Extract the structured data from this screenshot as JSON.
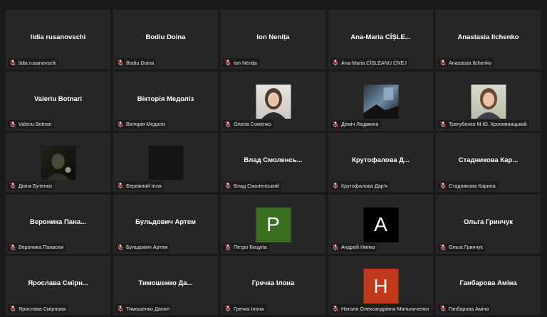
{
  "tiles": [
    {
      "display": "lidia rusanovschi",
      "label": "lidia rusanovschi",
      "type": "name"
    },
    {
      "display": "Bodiu Doina",
      "label": "Bodiu Doina",
      "type": "name"
    },
    {
      "display": "Ion Nenița",
      "label": "Ion Nenița",
      "type": "name"
    },
    {
      "display": "Ana-Maria CÎȘLE...",
      "label": "Ana-Maria CÎȘLEANU CNEJ",
      "type": "name"
    },
    {
      "display": "Anastasia Ilchenko",
      "label": "Anastasia Ilchenko",
      "type": "name"
    },
    {
      "display": "Valeriu Botnari",
      "label": "Valeriu Botnari",
      "type": "name"
    },
    {
      "display": "Вікторія Медоліз",
      "label": "Вікторія Медоліз",
      "type": "name"
    },
    {
      "display": "",
      "label": "Олена Соменко",
      "type": "video",
      "video": "portrait-light"
    },
    {
      "display": "",
      "label": "Деміч Людмила",
      "type": "video",
      "video": "dark-window"
    },
    {
      "display": "",
      "label": "Трегубенко М.Ю. Кропивницький",
      "type": "video",
      "video": "portrait-room"
    },
    {
      "display": "",
      "label": "Діана Бутенко",
      "type": "video",
      "video": "dark-person"
    },
    {
      "display": "",
      "label": "Бережний Ілля",
      "type": "video",
      "video": "black"
    },
    {
      "display": "Влад  Смоленсь...",
      "label": "Влад Смоленський",
      "type": "name"
    },
    {
      "display": "Крутофалова  Д...",
      "label": "Крутофалова Дар'я",
      "type": "name"
    },
    {
      "display": "Стадникова  Кар...",
      "label": "Стадникова Карина",
      "type": "name"
    },
    {
      "display": "Вероника  Пана...",
      "label": "Вероника Панасюк",
      "type": "name"
    },
    {
      "display": "Бульдович Артем",
      "label": "Бульдович Артем",
      "type": "name"
    },
    {
      "display": "",
      "label": "Петро Боцула",
      "type": "letter",
      "letter": "P",
      "color": "#3a6e22"
    },
    {
      "display": "",
      "label": "Андрей Нипка",
      "type": "letter",
      "letter": "A",
      "color": "#000000"
    },
    {
      "display": "Ольга Гринчук",
      "label": "Ольга Гринчук",
      "type": "name"
    },
    {
      "display": "Ярослава  Смірн...",
      "label": "Ярослава Смірнова",
      "type": "name"
    },
    {
      "display": "Тимошенко  Да...",
      "label": "Тимошенко Данил",
      "type": "name"
    },
    {
      "display": "Гречка Ілона",
      "label": "Гречка Ілона",
      "type": "name"
    },
    {
      "display": "",
      "label": "Наталя Олександрівна Мильниченко",
      "type": "letter",
      "letter": "H",
      "color": "#c0391a"
    },
    {
      "display": "Ганбарова Аміна",
      "label": "Ганбарова Аміна",
      "type": "name"
    }
  ],
  "colors": {
    "muted_mic": "#e02424",
    "tile_bg": "#262626",
    "page_bg": "#1a1a1a"
  },
  "icons": {
    "mic": "muted-mic-icon"
  }
}
